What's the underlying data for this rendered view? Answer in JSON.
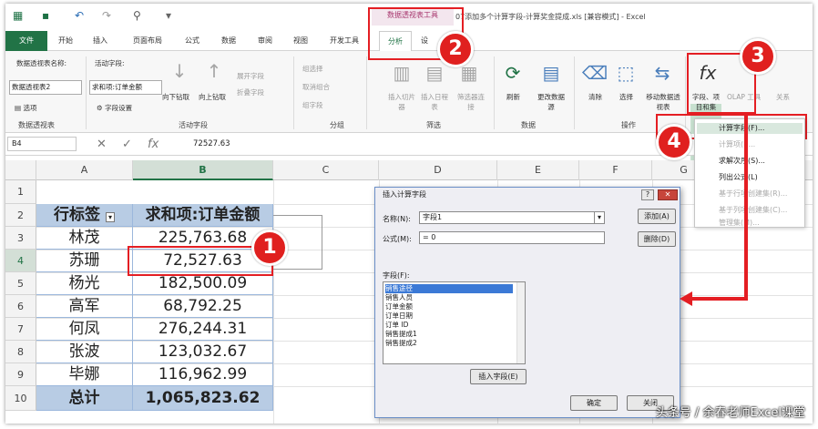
{
  "titlebar": {
    "context_group": "数据透视表工具",
    "doc_title": "07添加多个计算字段-计算奖金提成.xls [兼容模式] - Excel"
  },
  "tabs": [
    "文件",
    "开始",
    "插入",
    "页面布局",
    "公式",
    "数据",
    "审阅",
    "视图",
    "开发工具",
    "分析",
    "设"
  ],
  "ribbon": {
    "pivot_name_label": "数据透视表名称:",
    "pivot_name_value": "数据透视表2",
    "options_label": "选项",
    "group_pivot": "数据透视表",
    "active_field_label": "活动字段:",
    "active_field_value": "求和项:订单金额",
    "field_settings": "字段设置",
    "drill_down": "向下钻取",
    "drill_up": "向上钻取",
    "expand_field": "展开字段",
    "collapse_field": "折叠字段",
    "group_active": "活动字段",
    "group_selection": "组选择",
    "ungroup": "取消组合",
    "group_field": "组字段",
    "group_grouping": "分组",
    "insert_slicer": "插入切片器",
    "insert_timeline": "插入日程表",
    "filter_connections": "筛选器连接",
    "group_filter": "筛选",
    "refresh": "刷新",
    "change_source": "更改数据源",
    "group_data": "数据",
    "clear": "清除",
    "select": "选择",
    "move_pivot": "移动数据透视表",
    "group_actions": "操作",
    "fields_items": "字段、项目和集",
    "olap_tools": "OLAP 工具",
    "relationships": "关系"
  },
  "menu": {
    "items": [
      "计算字段(F)...",
      "计算项(I)...",
      "求解次序(S)...",
      "列出公式(L)",
      "基于行项创建集(R)...",
      "基于列项创建集(C)...",
      "管理集(M)..."
    ]
  },
  "formula_bar": {
    "cell_ref": "B4",
    "value": "72527.63"
  },
  "columns": [
    "A",
    "B",
    "C",
    "D",
    "E",
    "F",
    "G"
  ],
  "rows": [
    "1",
    "2",
    "3",
    "4",
    "5",
    "6",
    "7",
    "8",
    "9",
    "10"
  ],
  "table": {
    "header": [
      "行标签",
      "求和项:订单金额"
    ],
    "rows": [
      [
        "林茂",
        "225,763.68"
      ],
      [
        "苏珊",
        "72,527.63"
      ],
      [
        "杨光",
        "182,500.09"
      ],
      [
        "高军",
        "68,792.25"
      ],
      [
        "何凤",
        "276,244.31"
      ],
      [
        "张波",
        "123,032.67"
      ],
      [
        "毕娜",
        "116,962.99"
      ]
    ],
    "total": [
      "总计",
      "1,065,823.62"
    ]
  },
  "dialog": {
    "title": "插入计算字段",
    "name_label": "名称(N):",
    "name_value": "字段1",
    "formula_label": "公式(M):",
    "formula_value": "= 0",
    "add_btn": "添加(A)",
    "delete_btn": "删除(D)",
    "fields_label": "字段(F):",
    "fields": [
      "销售途径",
      "销售人员",
      "订单金额",
      "订单日期",
      "订单 ID",
      "销售提成1",
      "销售提成2"
    ],
    "insert_field_btn": "插入字段(E)",
    "ok_btn": "确定",
    "close_btn": "关闭"
  },
  "badges": [
    "1",
    "2",
    "3",
    "4"
  ],
  "watermark": "头条号 / 余春老师Excel课堂",
  "colors": {
    "excel_green": "#217346",
    "header_blue": "#b8cce4",
    "highlight_red": "#e41e23"
  }
}
